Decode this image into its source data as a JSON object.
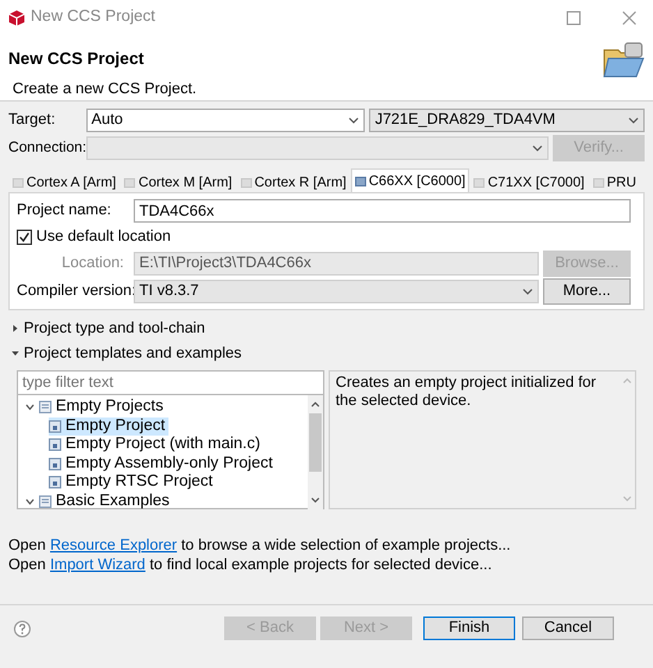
{
  "window": {
    "title": "New CCS Project"
  },
  "header": {
    "title": "New CCS Project",
    "subtitle": "Create a new CCS Project."
  },
  "target": {
    "label": "Target:",
    "value": "Auto",
    "device": "J721E_DRA829_TDA4VM"
  },
  "connection": {
    "label": "Connection:",
    "button": "Verify...",
    "button_disabled": true
  },
  "tabs": [
    {
      "label": "Cortex A [Arm]",
      "selected": false
    },
    {
      "label": "Cortex M [Arm]",
      "selected": false
    },
    {
      "label": "Cortex R [Arm]",
      "selected": false
    },
    {
      "label": "C66XX [C6000]",
      "selected": true
    },
    {
      "label": "C71XX [C7000]",
      "selected": false
    },
    {
      "label": "PRU",
      "selected": false
    }
  ],
  "project_name": {
    "label": "Project name:",
    "value": "TDA4C66x"
  },
  "use_default_location": {
    "label": "Use default location",
    "checked": true
  },
  "location": {
    "label": "Location:",
    "value": "E:\\TI\\Project3\\TDA4C66x",
    "disabled": true,
    "button": "Browse..."
  },
  "compiler_version": {
    "label": "Compiler version:",
    "value": "TI v8.3.7",
    "button": "More..."
  },
  "sections": [
    {
      "label": "Project type and tool-chain",
      "expanded": false
    },
    {
      "label": "Project templates and examples",
      "expanded": true
    }
  ],
  "templates": {
    "filter_placeholder": "type filter text",
    "tree": [
      {
        "label": "Empty Projects",
        "expanded": true,
        "children": [
          {
            "label": "Empty Project",
            "selected": true
          },
          {
            "label": "Empty Project (with main.c)",
            "selected": false
          },
          {
            "label": "Empty Assembly-only Project",
            "selected": false
          },
          {
            "label": "Empty RTSC Project",
            "selected": false
          }
        ]
      },
      {
        "label": "Basic Examples",
        "expanded": true
      }
    ],
    "description": "Creates an empty project initialized for the selected device."
  },
  "links": [
    {
      "before": "Open ",
      "link": "Resource Explorer",
      "after": " to browse a wide selection of example projects..."
    },
    {
      "before": "Open ",
      "link": "Import Wizard",
      "after": " to find local example projects for selected device..."
    }
  ],
  "buttons": [
    {
      "label": "< Back",
      "disabled": true,
      "default": false
    },
    {
      "label": "Next >",
      "disabled": true,
      "default": false
    },
    {
      "label": "Finish",
      "disabled": false,
      "default": true
    },
    {
      "label": "Cancel",
      "disabled": false,
      "default": false
    }
  ]
}
